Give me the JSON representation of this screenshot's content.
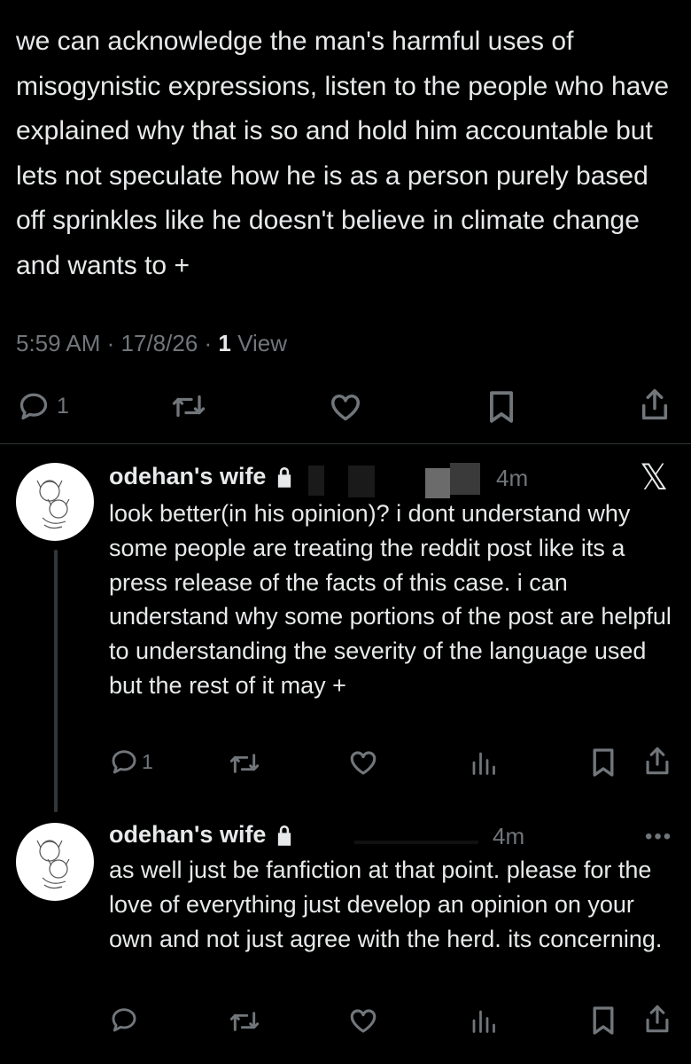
{
  "post": {
    "text": "we can acknowledge the man's harmful uses of misogynistic expressions, listen to the people who have explained why that is so and hold him accountable but lets not speculate how he is as a person purely based off sprinkles like he doesn't believe in climate change and wants to +",
    "time": "5:59 AM",
    "date": "17/8/26",
    "views_count": "1",
    "views_label": "View",
    "reply_count": "1"
  },
  "replies": [
    {
      "author": "odehan's wife",
      "age": "4m",
      "text": "look better(in his opinion)? i dont understand why some people are treating the reddit post like its a press release of the facts of this case. i can understand why some portions of the post are helpful to understanding the severity of the language used but the rest of it may +",
      "reply_count": "1",
      "close_glyph": "𝕏"
    },
    {
      "author": "odehan's wife",
      "age": "4m",
      "text": "as well just be fanfiction at that point. please for the love of everything just develop an opinion on your own and not just agree with the herd. its concerning.",
      "reply_count": "",
      "more_glyph": "•••"
    }
  ],
  "colors": {
    "background": "#000000",
    "text": "#e7e9ea",
    "muted": "#71767b",
    "divider": "#2f3336"
  },
  "icons": [
    "reply-icon",
    "retweet-icon",
    "like-icon",
    "bookmark-icon",
    "share-icon",
    "views-icon",
    "lock-icon",
    "close-icon",
    "more-icon"
  ]
}
